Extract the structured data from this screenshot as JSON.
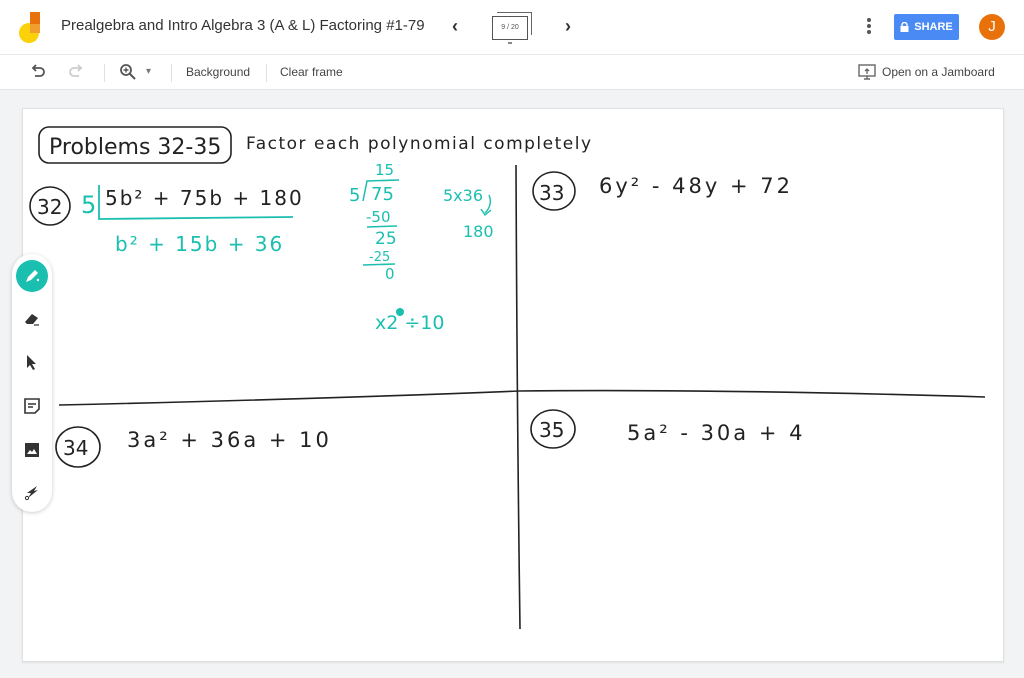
{
  "app": {
    "title": "Prealgebra and Intro Algebra 3 (A & L) Factoring #1-79",
    "frame_indicator": "9 / 20",
    "prev_frame_icon": "chevron-left-icon",
    "next_frame_icon": "chevron-right-icon",
    "share_label": "SHARE",
    "avatar_initial": "J",
    "brand_color": "#4a8af4",
    "avatar_color": "#e8710a"
  },
  "toolbar": {
    "undo_icon": "undo-icon",
    "redo_icon": "redo-icon",
    "zoom_icon": "zoom-in-icon",
    "background_label": "Background",
    "clear_frame_label": "Clear frame",
    "open_jamboard_label": "Open on a Jamboard"
  },
  "tools": [
    {
      "name": "pen",
      "icon": "pen-icon",
      "active": true
    },
    {
      "name": "eraser",
      "icon": "eraser-icon",
      "active": false
    },
    {
      "name": "select",
      "icon": "cursor-icon",
      "active": false
    },
    {
      "name": "sticky-note",
      "icon": "sticky-note-icon",
      "active": false
    },
    {
      "name": "image",
      "icon": "image-icon",
      "active": false
    },
    {
      "name": "laser",
      "icon": "laser-icon",
      "active": false
    }
  ],
  "board": {
    "header_box": "Problems 32-35",
    "instruction": "Factor each polynomial completely",
    "ink_color": "#1bbfb0",
    "problems": [
      {
        "number": "32",
        "expression": "5b² + 75b + 180",
        "factored_out": "5",
        "quotient": "b² + 15b + 36"
      },
      {
        "number": "33",
        "expression": "6y² - 48y + 72"
      },
      {
        "number": "34",
        "expression": "3a² + 36a + 10"
      },
      {
        "number": "35",
        "expression": "5a² - 30a + 4"
      }
    ],
    "scratch_work": {
      "division_quotient": "15",
      "division_divisor": "5",
      "division_dividend": "75",
      "division_step1": "-50",
      "division_remainder1": "25",
      "division_step2": "-25",
      "division_remainder2": "0",
      "multiply_note": "5x36",
      "multiply_result": "180",
      "note": "x2 ÷10"
    }
  }
}
